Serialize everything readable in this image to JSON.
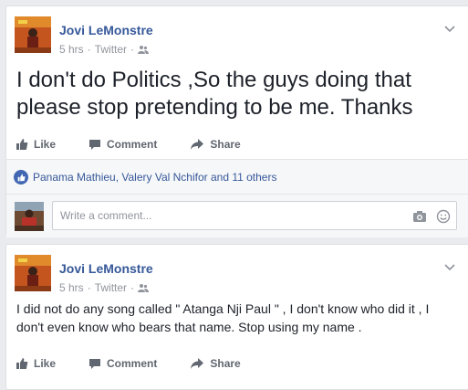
{
  "posts": [
    {
      "author": "Jovi LeMonstre",
      "time": "5 hrs",
      "source": "Twitter",
      "text": "I don't do Politics ,So the guys doing that please stop pretending to be me. Thanks",
      "actions": {
        "like": "Like",
        "comment": "Comment",
        "share": "Share"
      },
      "likes_text": "Panama Mathieu, Valery Val Nchifor and 11 others",
      "comment_placeholder": "Write a comment..."
    },
    {
      "author": "Jovi LeMonstre",
      "time": "5 hrs",
      "source": "Twitter",
      "text": "I did not do any song called \" Atanga Nji Paul \" , I don't know who did it , I don't even know who bears that name. Stop using my name .",
      "actions": {
        "like": "Like",
        "comment": "Comment",
        "share": "Share"
      }
    }
  ],
  "icons": {
    "like": "thumbs-up-icon",
    "comment": "speech-bubble-icon",
    "share": "share-arrow-icon",
    "audience": "friends-icon",
    "menu": "chevron-down-icon",
    "camera": "camera-icon",
    "emoji": "smiley-icon"
  },
  "colors": {
    "link": "#365899",
    "text": "#1d2129",
    "muted": "#90949c",
    "action": "#616770",
    "background": "#e9ebee"
  }
}
